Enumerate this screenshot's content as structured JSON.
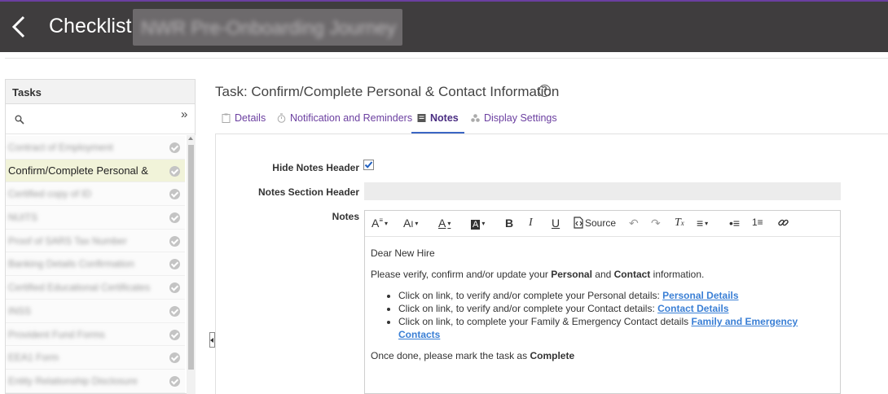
{
  "header": {
    "title": "Checklist:",
    "blurred_name": "NWR Pre-Onboarding Journey"
  },
  "tasks_panel": {
    "title": "Tasks",
    "expand_glyph": "»",
    "items": [
      {
        "label": "Contract of Employment",
        "blurred": true,
        "active": false
      },
      {
        "label": "Confirm/Complete Personal & ...",
        "blurred": false,
        "active": true
      },
      {
        "label": "Certified copy of ID",
        "blurred": true,
        "active": false
      },
      {
        "label": "NUITS",
        "blurred": true,
        "active": false
      },
      {
        "label": "Proof of SARS Tax Number",
        "blurred": true,
        "active": false
      },
      {
        "label": "Banking Details Confirmation",
        "blurred": true,
        "active": false
      },
      {
        "label": "Certified Educational Certificates",
        "blurred": true,
        "active": false
      },
      {
        "label": "INSS",
        "blurred": true,
        "active": false
      },
      {
        "label": "Provident Fund Forms",
        "blurred": true,
        "active": false
      },
      {
        "label": "EEA1 Form",
        "blurred": true,
        "active": false
      },
      {
        "label": "Entity Relationship Disclosure",
        "blurred": true,
        "active": false
      }
    ]
  },
  "main": {
    "task_title": "Task: Confirm/Complete Personal & Contact Information",
    "help_glyph": "?",
    "tabs": [
      {
        "label": "Details",
        "icon": "clipboard-icon",
        "active": false
      },
      {
        "label": "Notification and Reminders",
        "icon": "stopwatch-icon",
        "active": false
      },
      {
        "label": "Notes",
        "icon": "notes-icon",
        "active": true
      },
      {
        "label": "Display Settings",
        "icon": "display-settings-icon",
        "active": false
      }
    ],
    "fields": {
      "hide_notes_header_label": "Hide Notes Header",
      "hide_notes_header_checked": true,
      "notes_section_header_label": "Notes Section Header",
      "notes_section_header_value": "",
      "notes_label": "Notes"
    },
    "editor": {
      "toolbar": {
        "font_family": "A",
        "font_size": "A",
        "font_color": "A",
        "bg_color": "A",
        "bold": "B",
        "italic": "I",
        "underline": "U",
        "source": "Source",
        "undo": "↶",
        "redo": "↷",
        "clear_format": "T",
        "align": "≡",
        "bullets": "•≡",
        "numbers": "1≡",
        "link": "🔗"
      },
      "content": {
        "greeting": "Dear New Hire",
        "intro_pre": "Please verify, confirm and/or update your ",
        "intro_b1": "Personal",
        "intro_mid": " and ",
        "intro_b2": "Contact",
        "intro_post": " information.",
        "bullets": [
          {
            "text": "Click on link, to verify and/or complete your Personal details:  ",
            "link": "Personal Details"
          },
          {
            "text": "Click on link, to verify and/or complete your Contact details:  ",
            "link": "Contact Details"
          },
          {
            "text": "Click on link, to complete your Family & Emergency Contact details  ",
            "link": "Family and Emergency Contacts"
          }
        ],
        "closing_pre": "Once done, please mark the task as ",
        "closing_b": "Complete"
      }
    }
  },
  "colors": {
    "header_bg": "#3f3d3e",
    "accent_purple": "#6b3fa0",
    "link_blue": "#3a7fd5",
    "active_task_bg": "#f1f3d9"
  }
}
